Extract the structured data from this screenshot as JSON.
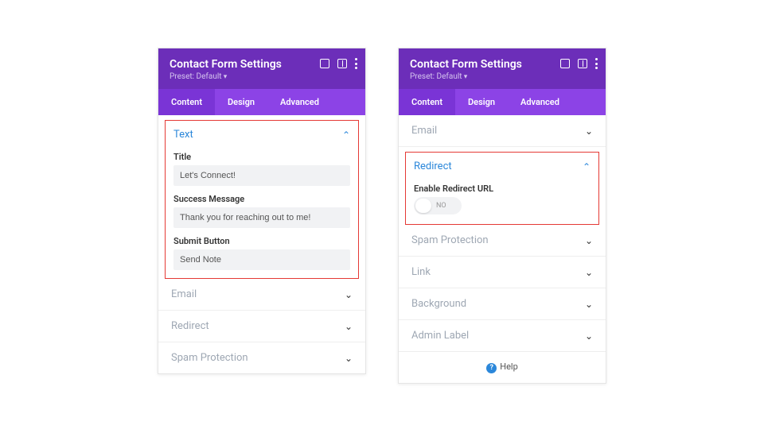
{
  "left": {
    "header": {
      "title": "Contact Form Settings",
      "preset": "Preset: Default"
    },
    "tabs": {
      "content": "Content",
      "design": "Design",
      "advanced": "Advanced"
    },
    "text_section": {
      "title": "Text",
      "fields": {
        "title_label": "Title",
        "title_value": "Let's Connect!",
        "success_label": "Success Message",
        "success_value": "Thank you for reaching out to me!",
        "submit_label": "Submit Button",
        "submit_value": "Send Note"
      }
    },
    "sections": {
      "email": "Email",
      "redirect": "Redirect",
      "spam": "Spam Protection"
    }
  },
  "right": {
    "header": {
      "title": "Contact Form Settings",
      "preset": "Preset: Default"
    },
    "tabs": {
      "content": "Content",
      "design": "Design",
      "advanced": "Advanced"
    },
    "sections": {
      "email": "Email",
      "redirect": "Redirect",
      "redirect_field_label": "Enable Redirect URL",
      "redirect_toggle_value": "NO",
      "spam": "Spam Protection",
      "link": "Link",
      "background": "Background",
      "admin_label": "Admin Label"
    },
    "help": "Help"
  }
}
